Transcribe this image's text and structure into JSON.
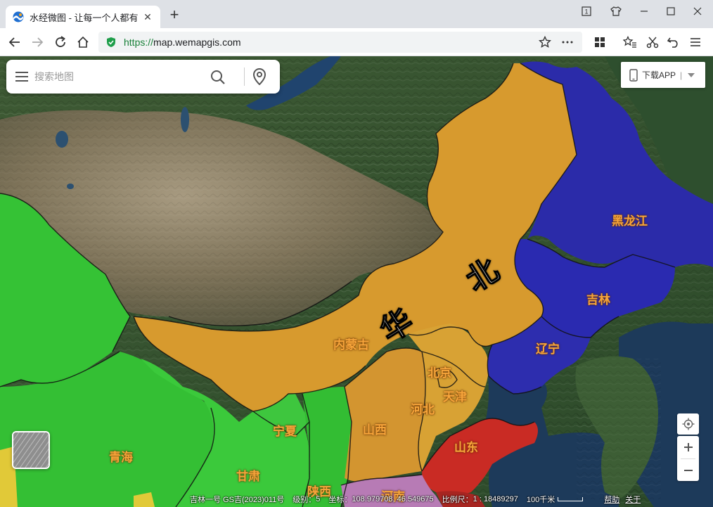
{
  "browser": {
    "tab_title": "水经微图 - 让每一个人都有自",
    "url_scheme": "https://",
    "url_host": "map.wemapgis.com"
  },
  "search": {
    "placeholder": "搜索地图"
  },
  "app_download": {
    "label": "下载APP",
    "separator": "|"
  },
  "map": {
    "region_labels": [
      "华",
      "北"
    ],
    "provinces": [
      {
        "name": "黑龙江",
        "color": "#2a2aa8"
      },
      {
        "name": "吉林",
        "color": "#2a2aa8"
      },
      {
        "name": "辽宁",
        "color": "#2a2aa8"
      },
      {
        "name": "内蒙古",
        "color": "#d79a2e"
      },
      {
        "name": "北京",
        "color": "#d79a2e"
      },
      {
        "name": "天津",
        "color": "#d79a2e"
      },
      {
        "name": "河北",
        "color": "#d79a2e"
      },
      {
        "name": "山西",
        "color": "#d79a2e"
      },
      {
        "name": "山东",
        "color": "#c92b24"
      },
      {
        "name": "宁夏",
        "color": "#33c233"
      },
      {
        "name": "青海",
        "color": "#33c233"
      },
      {
        "name": "甘肃",
        "color": "#33c233"
      },
      {
        "name": "陕西",
        "color": "#33c233"
      },
      {
        "name": "河南",
        "color": "#b77bb5"
      }
    ]
  },
  "status": {
    "attribution": "吉林一号 GS吉(2023)011号",
    "level_label": "级别：",
    "level_value": "5",
    "coord_label": "坐标：",
    "coord_value": "108.979708, 46.549675",
    "scale_label": "比例尺：",
    "scale_value": "1 : 18489297",
    "scale_bar": "100千米",
    "help": "帮助",
    "about": "关于"
  }
}
